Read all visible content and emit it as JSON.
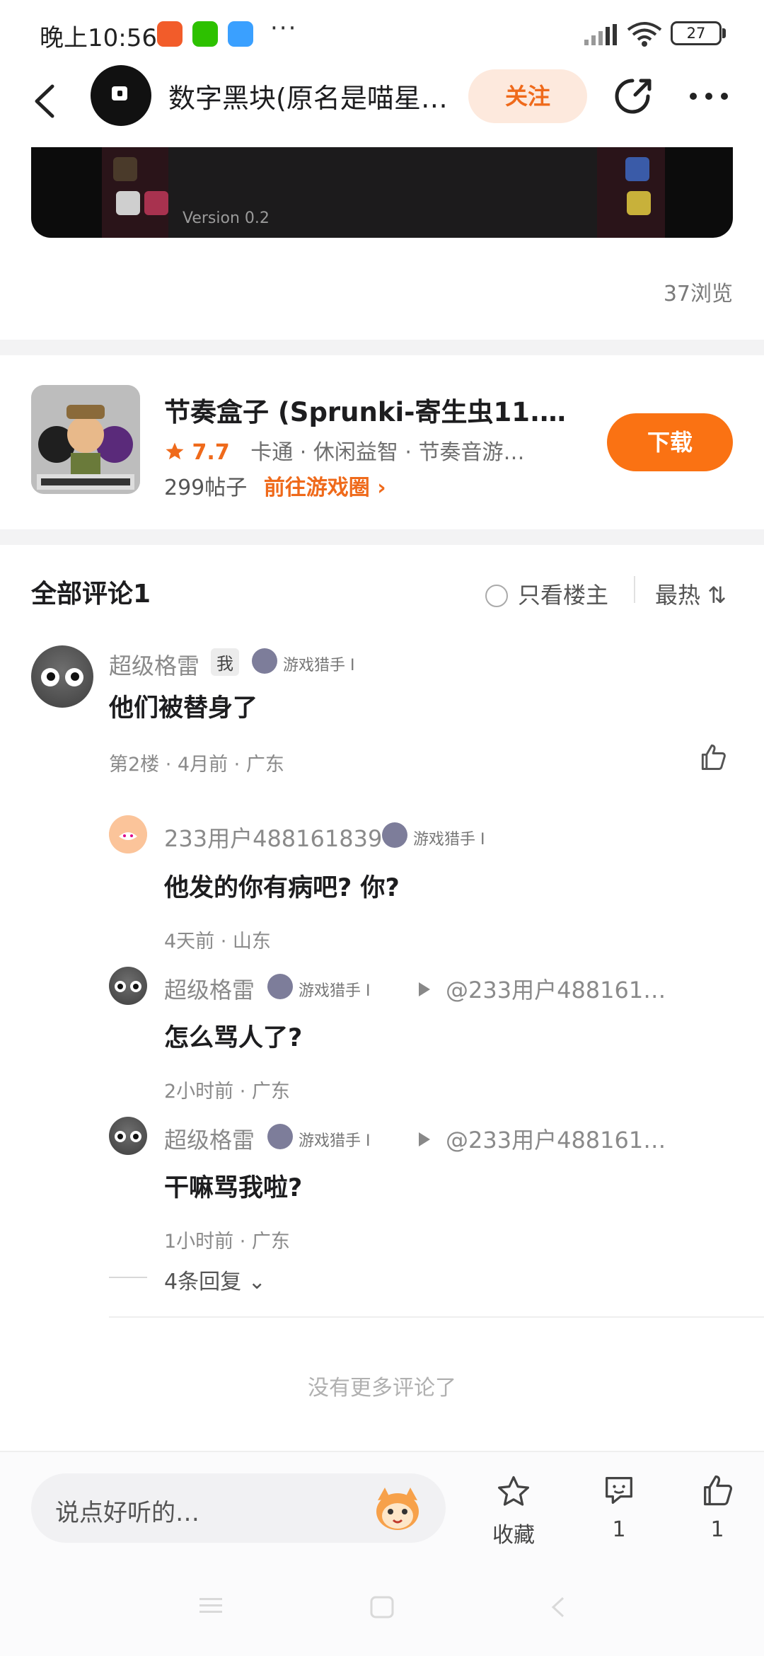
{
  "status_bar": {
    "time": "晚上10:56",
    "more": "···",
    "battery": "27"
  },
  "nav": {
    "title": "数字黑块(原名是喵星…",
    "follow_label": "关注"
  },
  "post": {
    "video_caption": "Version 0.2",
    "views": "37浏览"
  },
  "game": {
    "title": "节奏盒子 (Sprunki-寄生虫11.…",
    "rating": "7.7",
    "tags": "卡通 · 休闲益智 · 节奏音游…",
    "posts": "299帖子",
    "goto_label": "前往游戏圈 ›",
    "download_label": "下载"
  },
  "comments_header": {
    "title": "全部评论1",
    "only_op": "只看楼主",
    "sort": "最热 ⇅"
  },
  "comments": [
    {
      "user": "超级格雷",
      "me_tag": "我",
      "badge": "游戏猎手 I",
      "text": "他们被替身了",
      "meta": "第2楼 · 4月前 · 广东"
    }
  ],
  "replies": [
    {
      "user": "233用户488161839",
      "badge": "游戏猎手 I",
      "text": "他发的你有病吧? 你?",
      "meta": "4天前 · 山东"
    },
    {
      "user": "超级格雷",
      "badge": "游戏猎手 I",
      "reply_to": "@233用户488161…",
      "text": "怎么骂人了?",
      "meta": "2小时前 · 广东"
    },
    {
      "user": "超级格雷",
      "badge": "游戏猎手 I",
      "reply_to": "@233用户488161…",
      "text": "干嘛骂我啦?",
      "meta": "1小时前 · 广东"
    }
  ],
  "more_replies": "4条回复 ⌄",
  "no_more": "没有更多评论了",
  "bottom_bar": {
    "input_placeholder": "说点好听的…",
    "favorite_label": "收藏",
    "comment_count": "1",
    "like_count": "1"
  },
  "colors": {
    "accent": "#fa7213",
    "follow_bg": "#fde9dd"
  },
  "icons": [
    "back-arrow-icon",
    "share-icon",
    "more-dots-icon",
    "star-icon",
    "radio-icon",
    "like-icon",
    "favorite-star-icon",
    "comment-bubble-icon",
    "thumbs-up-icon",
    "mascot-icon"
  ]
}
